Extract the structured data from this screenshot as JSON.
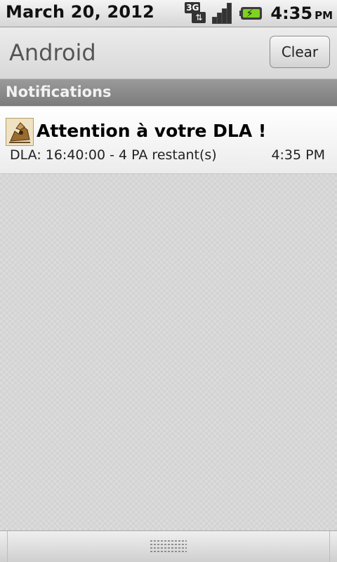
{
  "status_bar": {
    "date": "March 20, 2012",
    "network_label": "3G",
    "network_arrows": "⇅",
    "battery_bolt": "⚡",
    "time": "4:35",
    "ampm": "PM",
    "icons": [
      "3g-data-icon",
      "signal-strength-icon",
      "battery-charging-icon"
    ]
  },
  "header": {
    "title": "Android",
    "clear_label": "Clear"
  },
  "section": {
    "title": "Notifications"
  },
  "notifications": [
    {
      "icon": "app-icon",
      "title": "Attention à votre DLA !",
      "text": "DLA: 16:40:00 - 4 PA restant(s)",
      "time": "4:35 PM"
    }
  ],
  "colors": {
    "battery_fill": "#7ed321",
    "section_bg": "#8a8a8a"
  }
}
